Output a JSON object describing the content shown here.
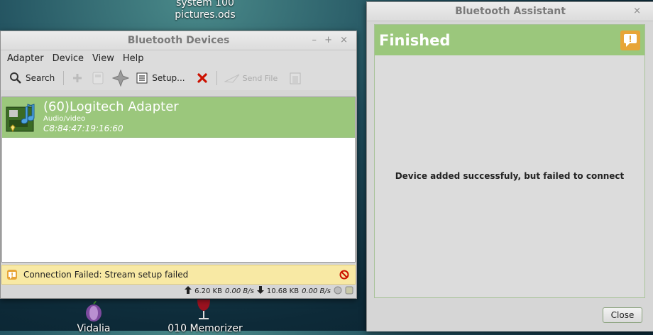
{
  "desktop": {
    "file_label": "system 100\npictures.ods",
    "icon1_label": "Vidalia",
    "icon2_label": "010 Memorizer"
  },
  "devices_window": {
    "title": "Bluetooth Devices",
    "controls": {
      "minimize": "–",
      "maximize": "+",
      "close": "×"
    },
    "menu": [
      "Adapter",
      "Device",
      "View",
      "Help"
    ],
    "toolbar": {
      "search": "Search",
      "setup": "Setup...",
      "send_file": "Send File"
    },
    "device": {
      "name": "(60)Logitech Adapter",
      "type": "Audio/video",
      "address": "C8:84:47:19:16:60"
    },
    "info_message": "Connection Failed: Stream setup failed",
    "status": {
      "up_total": "6.20 KB",
      "up_rate": "0.00 B/s",
      "down_total": "10.68 KB",
      "down_rate": "0.00 B/s"
    }
  },
  "assistant_window": {
    "title": "Bluetooth Assistant",
    "close_glyph": "×",
    "heading": "Finished",
    "message": "Device added successfuly, but failed to connect",
    "close_button": "Close"
  },
  "colors": {
    "selection_green": "#9bc77c",
    "warning_yellow": "#f8e9a4",
    "warn_orange": "#e7a537",
    "error_red": "#cc1100"
  }
}
